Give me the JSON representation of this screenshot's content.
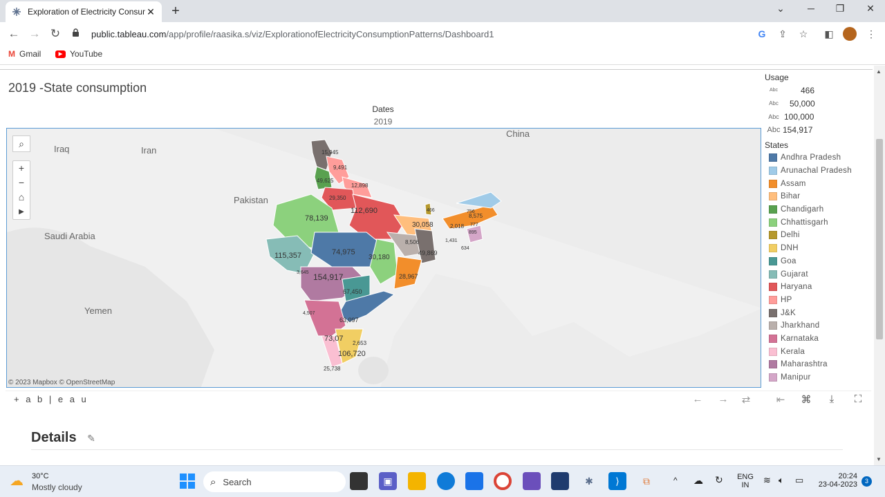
{
  "browser": {
    "tab_title": "Exploration of Electricity Consum",
    "url_host": "public.tableau.com",
    "url_path": "/app/profile/raasika.s/viz/ExplorationofElectricityConsumptionPatterns/Dashboard1",
    "bookmarks": [
      {
        "label": "Gmail"
      },
      {
        "label": "YouTube"
      }
    ]
  },
  "dashboard": {
    "title": "2019 -State consumption",
    "dates_label": "Dates",
    "dates_value": "2019",
    "map_attribution": "© 2023 Mapbox  © OpenStreetMap",
    "map_labels": [
      "Iraq",
      "Iran",
      "China",
      "Pakistan",
      "Saudi Arabia",
      "Yemen"
    ],
    "details_title": "Details",
    "tableau_logo": "+ a b | e a u"
  },
  "usage_legend": {
    "title": "Usage",
    "items": [
      {
        "abc": "Abc",
        "value": "466"
      },
      {
        "abc": "Abc",
        "value": "50,000"
      },
      {
        "abc": "Abc",
        "value": "100,000"
      },
      {
        "abc": "Abc",
        "value": "154,917"
      }
    ]
  },
  "states_legend": {
    "title": "States",
    "items": [
      {
        "name": "Andhra Pradesh",
        "color": "#4e79a7"
      },
      {
        "name": "Arunachal Pradesh",
        "color": "#a0cbe8"
      },
      {
        "name": "Assam",
        "color": "#f28e2b"
      },
      {
        "name": "Bihar",
        "color": "#ffbe7d"
      },
      {
        "name": "Chandigarh",
        "color": "#59a14f"
      },
      {
        "name": "Chhattisgarh",
        "color": "#8cd17d"
      },
      {
        "name": "Delhi",
        "color": "#b6992d"
      },
      {
        "name": "DNH",
        "color": "#f1ce63"
      },
      {
        "name": "Goa",
        "color": "#499894"
      },
      {
        "name": "Gujarat",
        "color": "#86bcb6"
      },
      {
        "name": "Haryana",
        "color": "#e15759"
      },
      {
        "name": "HP",
        "color": "#ff9d9a"
      },
      {
        "name": "J&K",
        "color": "#79706e"
      },
      {
        "name": "Jharkhand",
        "color": "#bab0ac"
      },
      {
        "name": "Karnataka",
        "color": "#d37295"
      },
      {
        "name": "Kerala",
        "color": "#fabfd2"
      },
      {
        "name": "Maharashtra",
        "color": "#b07aa1"
      },
      {
        "name": "Manipur",
        "color": "#d4a6c8"
      }
    ]
  },
  "state_values": [
    {
      "label": "15,945"
    },
    {
      "label": "9,491"
    },
    {
      "label": "49,625"
    },
    {
      "label": "12,898"
    },
    {
      "label": "29,350"
    },
    {
      "label": "112,690"
    },
    {
      "label": "78,139"
    },
    {
      "label": "30,058"
    },
    {
      "label": "2,018"
    },
    {
      "label": "8,575"
    },
    {
      "label": "756"
    },
    {
      "label": "777"
    },
    {
      "label": "895"
    },
    {
      "label": "115,357"
    },
    {
      "label": "74,975"
    },
    {
      "label": "8,506"
    },
    {
      "label": "49,869"
    },
    {
      "label": "1,431"
    },
    {
      "label": "634"
    },
    {
      "label": "30,180"
    },
    {
      "label": "154,917"
    },
    {
      "label": "3,645"
    },
    {
      "label": "28,967"
    },
    {
      "label": "67,450"
    },
    {
      "label": "4,507"
    },
    {
      "label": "63,097"
    },
    {
      "label": "73,07"
    },
    {
      "label": "2,653"
    },
    {
      "label": "106,720"
    },
    {
      "label": "25,738"
    },
    {
      "label": "466"
    }
  ],
  "taskbar": {
    "weather_temp": "30°C",
    "weather_desc": "Mostly cloudy",
    "search_label": "Search",
    "lang_top": "ENG",
    "lang_bottom": "IN",
    "time": "20:24",
    "date": "23-04-2023",
    "notif_count": "3"
  }
}
